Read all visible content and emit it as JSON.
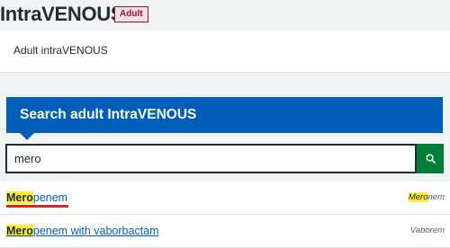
{
  "header": {
    "title": "IntraVENOUS",
    "badge": "Adult"
  },
  "subbar": {
    "text": "Adult intraVENOUS"
  },
  "search": {
    "heading": "Search adult IntraVENOUS",
    "value": "mero",
    "button_icon": "search-icon"
  },
  "results": [
    {
      "name_match": "Mero",
      "name_rest": "penem",
      "brand_match": "Mero",
      "brand_rest": "nem"
    },
    {
      "name_match": "Mero",
      "name_rest": "penem with vaborbactam",
      "brand_match": "",
      "brand_rest": "Vaborem"
    }
  ],
  "colors": {
    "nhs_blue": "#005eb8",
    "search_green": "#007f3b",
    "highlight_yellow": "#ffeb3b",
    "badge_red": "#8a1538",
    "focus_underline": "#d5281b"
  }
}
